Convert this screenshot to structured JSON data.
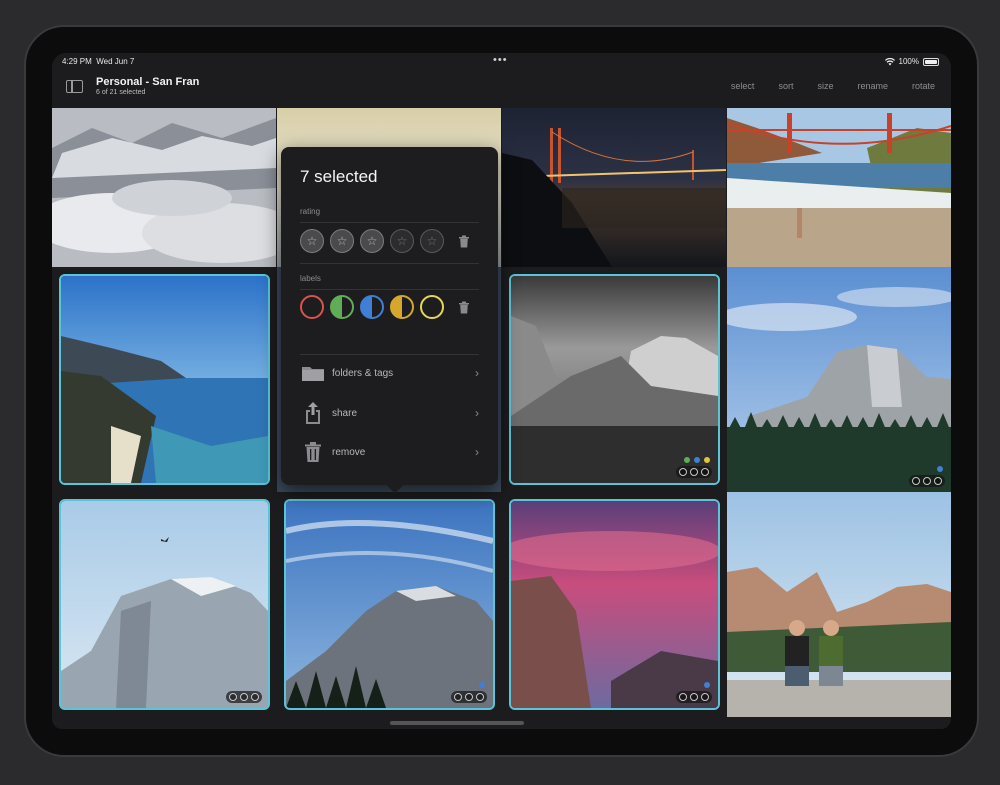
{
  "status_bar": {
    "time": "4:29 PM",
    "date": "Wed Jun 7",
    "battery": "100%",
    "dots": "•••"
  },
  "nav": {
    "title": "Personal - San Fran",
    "subtitle": "6 of 21 selected",
    "actions": [
      "select",
      "sort",
      "size",
      "rename",
      "rotate"
    ]
  },
  "popover": {
    "title": "7 selected",
    "rating_label": "rating",
    "labels_label": "labels",
    "stars": [
      1,
      1,
      1,
      0,
      0
    ],
    "label_colors": [
      "#d9534f",
      "#5fae57",
      "#3f7fd6",
      "#d5a72c",
      "#e6d84d"
    ],
    "rows": [
      {
        "icon": "folder-icon",
        "label": "folders & tags"
      },
      {
        "icon": "share-icon",
        "label": "share"
      },
      {
        "icon": "trash-icon",
        "label": "remove"
      }
    ]
  },
  "colors": {
    "accent": "#5bc4d6",
    "background": "#1c1c1e"
  }
}
